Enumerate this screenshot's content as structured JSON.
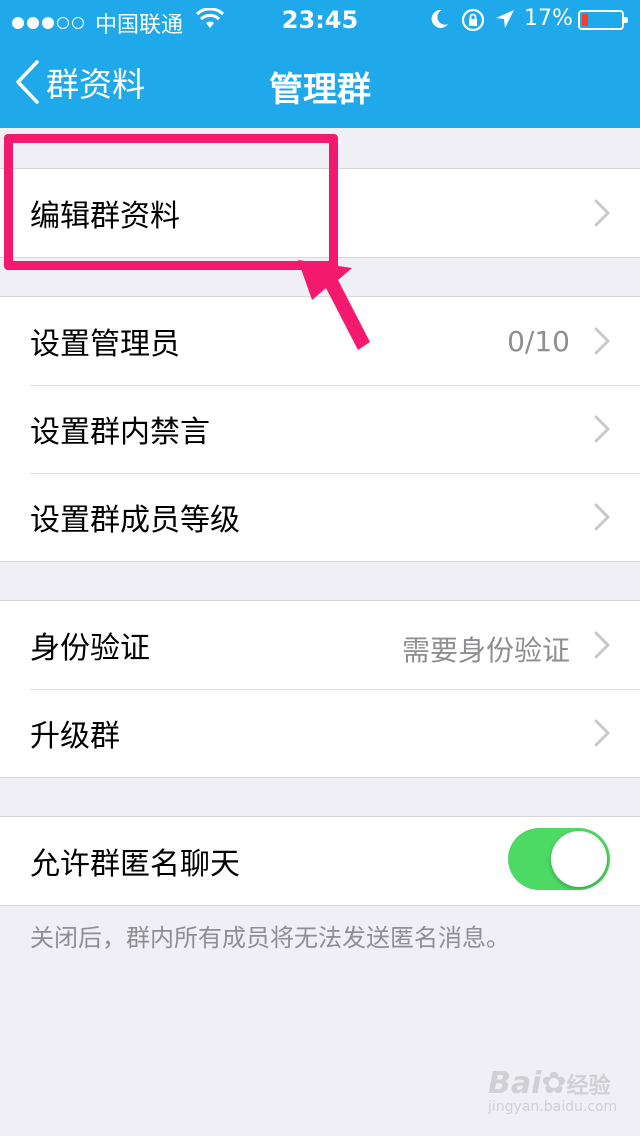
{
  "status_bar": {
    "carrier": "中国联通",
    "time": "23:45",
    "battery_percent": "17%",
    "battery_level": 0.17,
    "icons": [
      "signal-dots-icon",
      "wifi-icon",
      "moon-icon",
      "rotation-lock-icon",
      "location-icon",
      "battery-icon"
    ]
  },
  "nav": {
    "back_label": "群资料",
    "title": "管理群"
  },
  "sections": {
    "edit": {
      "label": "编辑群资料"
    },
    "admin": {
      "set_admin": {
        "label": "设置管理员",
        "value": "0/10"
      },
      "mute": {
        "label": "设置群内禁言"
      },
      "level": {
        "label": "设置群成员等级"
      }
    },
    "verify": {
      "identity": {
        "label": "身份验证",
        "value": "需要身份验证"
      },
      "upgrade": {
        "label": "升级群"
      }
    },
    "anon": {
      "label": "允许群匿名聊天",
      "toggle_on": true,
      "footnote": "关闭后，群内所有成员将无法发送匿名消息。"
    }
  },
  "watermark": {
    "main": "Bai",
    "suffix": "经验",
    "sub": "jingyan.baidu.com"
  },
  "colors": {
    "nav_blue": "#1fa9ea",
    "toggle_green": "#4cd964",
    "highlight_pink": "#f2196e",
    "background": "#f0eff5"
  }
}
